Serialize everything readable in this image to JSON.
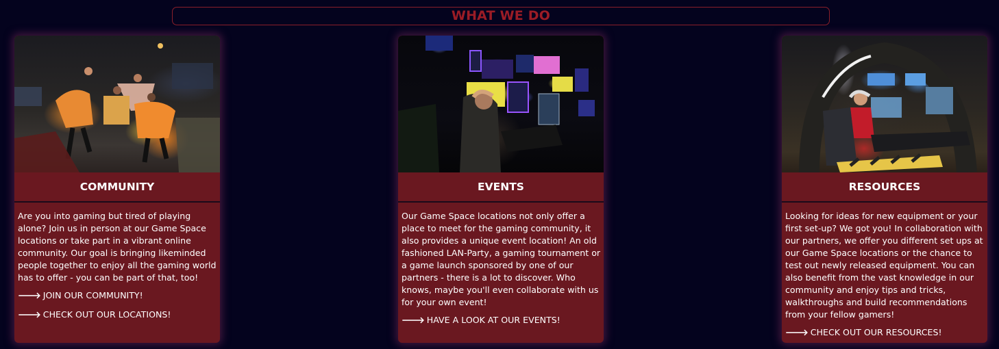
{
  "section": {
    "title": "WHAT WE DO"
  },
  "cards": [
    {
      "title": "COMMUNITY",
      "image_alt": "Friends cheering while gaming in a lounge",
      "description": "Are you into gaming but tired of playing alone? Join us in person at our Game Space locations or take part in a vibrant online community. Our goal is bringing likeminded people together to enjoy all the gaming world has to offer - you can be part of that, too!",
      "links": [
        "JOIN OUR COMMUNITY!",
        "CHECK OUT OUR LOCATIONS!"
      ]
    },
    {
      "title": "EVENTS",
      "image_alt": "Gamer in a neon-lit gaming room",
      "description": "Our Game Space locations not only offer a place to meet for the gaming community, it also provides a unique event location! An old fashioned LAN-Party, a gaming tournament or a game launch sponsored by one of our partners - there is a lot to discover. Who knows, maybe you'll even collaborate with us for your own event!",
      "links": [
        "HAVE A LOOK AT OUR EVENTS!"
      ]
    },
    {
      "title": "RESOURCES",
      "image_alt": "Gamer in a cockpit-style gaming rig",
      "description": "Looking for ideas for new equipment or your first set-up? We got you! In collaboration with our partners, we offer you different set ups at our Game Space locations or the chance to test out newly released equipment. You can also benefit from the vast knowledge in our community and enjoy tips and tricks, walkthroughs and build recommendations from your fellow gamers!",
      "links": [
        "CHECK OUT OUR RESOURCES!"
      ]
    }
  ],
  "link_arrow": "🡒"
}
